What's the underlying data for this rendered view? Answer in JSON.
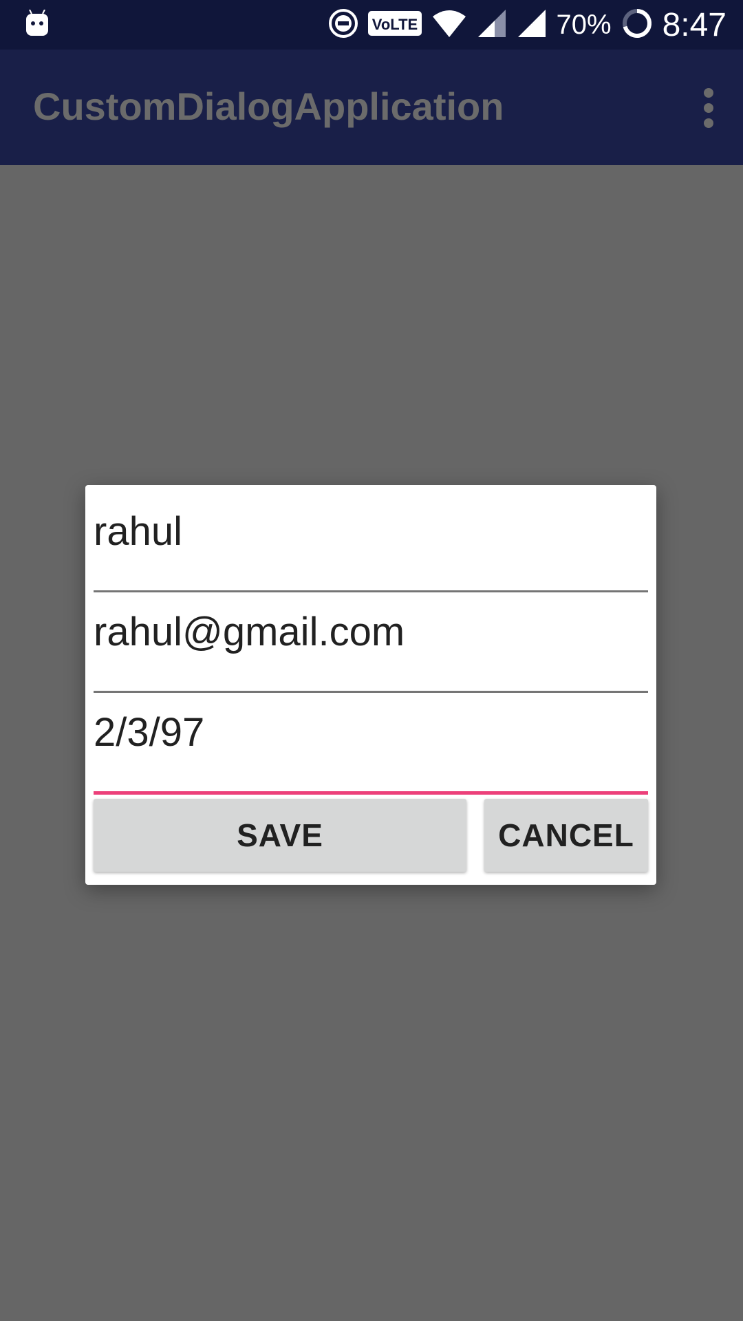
{
  "status_bar": {
    "battery_percent": "70%",
    "time": "8:47",
    "volte_label": "VoLTE",
    "icons": [
      "android-notification-icon",
      "do-not-disturb-icon",
      "volte-icon",
      "wifi-icon",
      "signal-1-icon",
      "signal-2-icon",
      "battery-icon"
    ]
  },
  "app_bar": {
    "title": "CustomDialogApplication",
    "menu_icon": "overflow-menu-icon"
  },
  "dialog": {
    "name_field": {
      "value": "rahul"
    },
    "email_field": {
      "value": "rahul@gmail.com"
    },
    "dob_field": {
      "value": "2/3/97"
    },
    "save_label": "SAVE",
    "cancel_label": "CANCEL",
    "accent_color": "#ec407a"
  },
  "colors": {
    "status_bar": "#10163a",
    "app_bar": "#191f48",
    "scrim": "#666666"
  }
}
